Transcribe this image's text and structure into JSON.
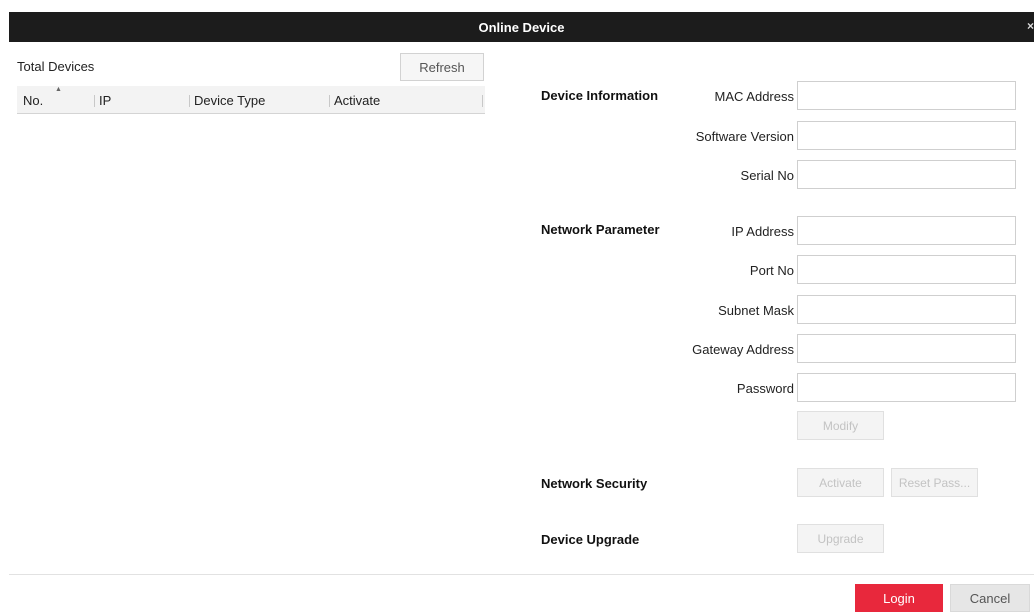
{
  "dialog": {
    "title": "Online Device",
    "close_glyph": "×"
  },
  "list": {
    "total_label": "Total Devices",
    "refresh_label": "Refresh",
    "columns": [
      "No.",
      "IP",
      "Device Type",
      "Activate"
    ],
    "sort_glyph": "▲"
  },
  "info": {
    "device_information": "Device Information",
    "mac_label": "MAC Address",
    "mac_value": "",
    "software_label": "Software Version",
    "software_value": "",
    "serial_label": "Serial No",
    "serial_value": "",
    "network_parameter": "Network Parameter",
    "ip_label": "IP Address",
    "ip_value": "",
    "port_label": "Port No",
    "port_value": "",
    "subnet_label": "Subnet Mask",
    "subnet_value": "",
    "gateway_label": "Gateway Address",
    "gateway_value": "",
    "password_label": "Password",
    "password_value": "",
    "modify_label": "Modify",
    "network_security": "Network Security",
    "activate_label": "Activate",
    "reset_label": "Reset Pass...",
    "device_upgrade": "Device Upgrade",
    "upgrade_label": "Upgrade"
  },
  "footer": {
    "login_label": "Login",
    "cancel_label": "Cancel"
  },
  "colors": {
    "titlebar": "#1c1c1c",
    "login": "#e8283c"
  }
}
